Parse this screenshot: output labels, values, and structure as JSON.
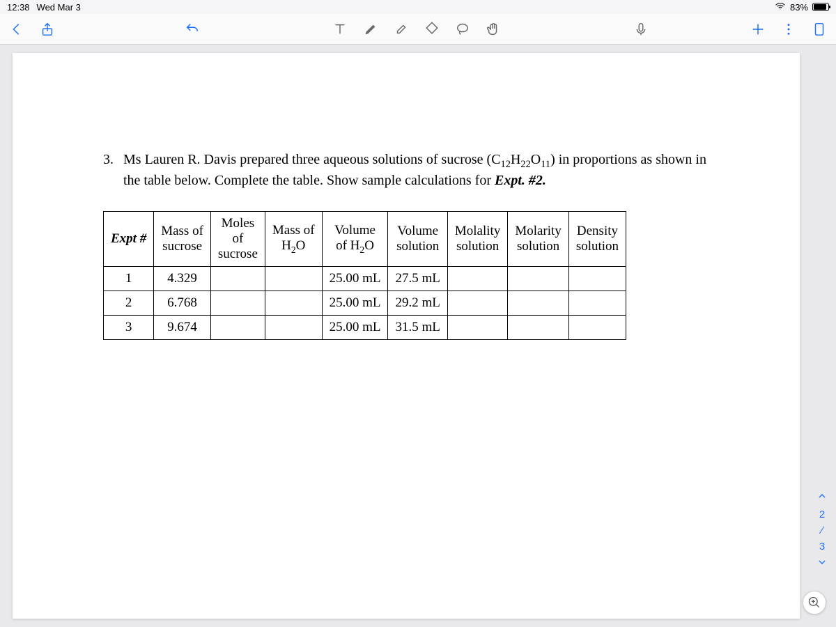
{
  "status": {
    "time": "12:38",
    "date": "Wed Mar 3",
    "battery_pct": "83%"
  },
  "question": {
    "number": "3.",
    "text_pre": "Ms Lauren R. Davis prepared three aqueous solutions of sucrose (C",
    "formula_12": "12",
    "text_h": "H",
    "formula_22": "22",
    "text_o": "O",
    "formula_11": "11",
    "text_mid": ") in proportions as shown in the table below. Complete the table.  Show sample calculations for ",
    "expt_label": "Expt. #2."
  },
  "table": {
    "headers": {
      "expt": "Expt #",
      "mass_sucrose_l1": "Mass of",
      "mass_sucrose_l2": "sucrose",
      "moles_l1": "Moles",
      "moles_l2": "of",
      "moles_l3": "sucrose",
      "mass_h2o_l1": "Mass of",
      "mass_h2o_l2": "H",
      "mass_h2o_sub": "2",
      "mass_h2o_l3": "O",
      "vol_h2o_l1": "Volume",
      "vol_h2o_l2": "of H",
      "vol_h2o_sub": "2",
      "vol_h2o_l3": "O",
      "vol_sol_l1": "Volume",
      "vol_sol_l2": "solution",
      "molality_l1": "Molality",
      "molality_l2": "solution",
      "molarity_l1": "Molarity",
      "molarity_l2": "solution",
      "density_l1": "Density",
      "density_l2": "solution"
    },
    "rows": [
      {
        "expt": "1",
        "mass_sucrose": "4.329",
        "vol_h2o": "25.00 mL",
        "vol_sol": "27.5 mL"
      },
      {
        "expt": "2",
        "mass_sucrose": "6.768",
        "vol_h2o": "25.00 mL",
        "vol_sol": "29.2 mL"
      },
      {
        "expt": "3",
        "mass_sucrose": "9.674",
        "vol_h2o": "25.00 mL",
        "vol_sol": "31.5 mL"
      }
    ]
  },
  "nav": {
    "current": "2",
    "total": "3"
  }
}
